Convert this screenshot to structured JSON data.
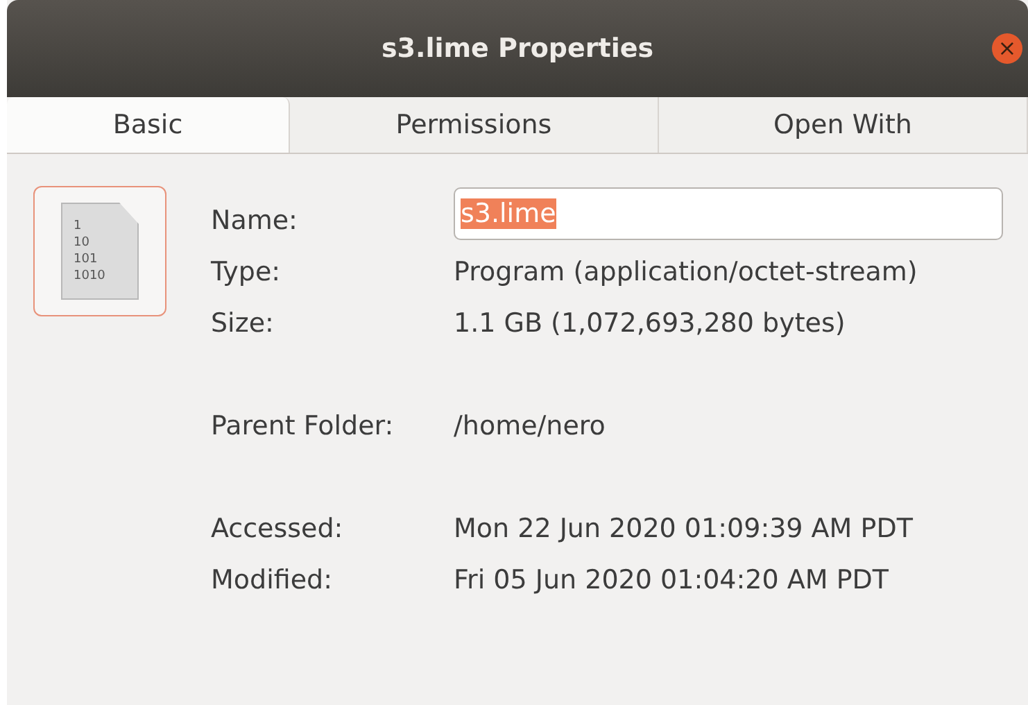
{
  "window": {
    "title": "s3.lime Properties",
    "close": "×"
  },
  "tabs": [
    {
      "label": "Basic",
      "selected": true
    },
    {
      "label": "Permissions",
      "selected": false
    },
    {
      "label": "Open With",
      "selected": false
    }
  ],
  "file_icon": {
    "lines": [
      "1",
      "10",
      "101",
      "1010"
    ]
  },
  "groups": [
    [
      {
        "label": "Name:",
        "kind": "field",
        "value": "s3.lime",
        "text_selected": true
      },
      {
        "label": "Type:",
        "kind": "text",
        "value": "Program (application/octet-stream)"
      },
      {
        "label": "Size:",
        "kind": "text",
        "value": "1.1 GB (1,072,693,280 bytes)"
      }
    ],
    [
      {
        "label": "Parent Folder:",
        "kind": "text",
        "value": "/home/nero"
      }
    ],
    [
      {
        "label": "Accessed:",
        "kind": "text",
        "value": "Mon 22 Jun 2020 01:09:39 AM PDT"
      },
      {
        "label": "Modified:",
        "kind": "text",
        "value": "Fri 05 Jun 2020 01:04:20 AM PDT"
      }
    ]
  ]
}
